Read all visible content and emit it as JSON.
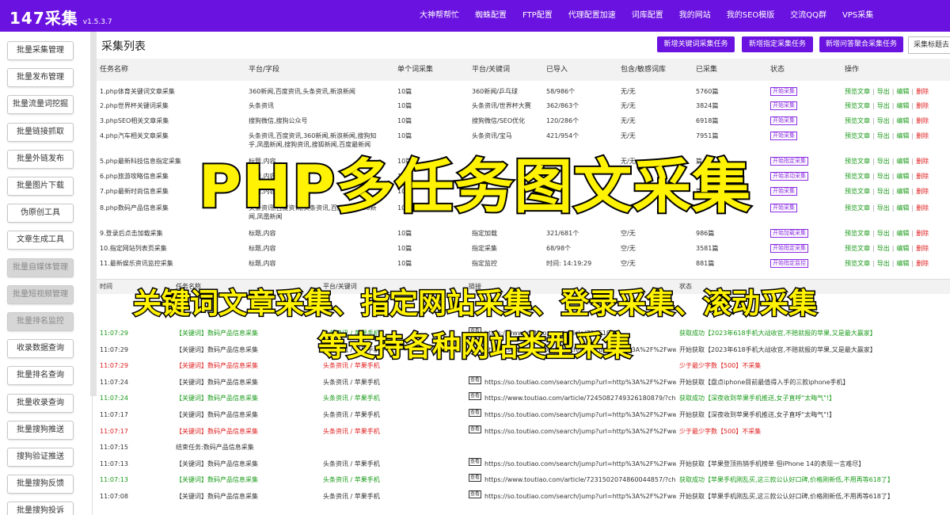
{
  "app": {
    "name": "147采集",
    "version": "v1.5.3.7"
  },
  "colors": {
    "brand": "#6a12e0",
    "green": "#1a9a1a",
    "red": "#e02020",
    "tag": "#8a2be2",
    "overlay": "#fff203"
  },
  "topnav": [
    "大神帮帮忙",
    "蜘蛛配置",
    "FTP配置",
    "代理配置加速",
    "词库配置",
    "我的网站",
    "我的SEO模版",
    "交流QQ群",
    "VPS采集"
  ],
  "sidebar": {
    "items": [
      {
        "label": "批量采集管理",
        "disabled": false
      },
      {
        "label": "批量发布管理",
        "disabled": false
      },
      {
        "label": "批量流量词挖掘",
        "disabled": false
      },
      {
        "label": "批量链接抓取",
        "disabled": false
      },
      {
        "label": "批量外链发布",
        "disabled": false
      },
      {
        "label": "批量图片下载",
        "disabled": false
      },
      {
        "label": "伪原创工具",
        "disabled": false
      },
      {
        "label": "文章生成工具",
        "disabled": false
      },
      {
        "label": "批量自媒体管理",
        "disabled": true
      },
      {
        "label": "批量短视频管理",
        "disabled": true
      },
      {
        "label": "批量排名监控",
        "disabled": true
      },
      {
        "label": "收录数据查询",
        "disabled": false
      },
      {
        "label": "批量排名查询",
        "disabled": false
      },
      {
        "label": "批量收录查询",
        "disabled": false
      },
      {
        "label": "批量搜狗推送",
        "disabled": false
      },
      {
        "label": "搜狗验证推送",
        "disabled": false
      },
      {
        "label": "批量搜狗反馈",
        "disabled": false
      },
      {
        "label": "批量搜狗投诉",
        "disabled": false
      }
    ]
  },
  "main": {
    "title": "采集列表",
    "actions": [
      "新增关键词采集任务",
      "新增指定采集任务",
      "新增问答聚合采集任务",
      "采集标题去"
    ],
    "task_columns": [
      "任务名称",
      "平台/字段",
      "单个词采集",
      "平台/关键词",
      "已导入",
      "包含/敏感词库",
      "已采集",
      "状态",
      "操作"
    ],
    "tasks": [
      {
        "name": "1.php体育关键词文章采集",
        "platform": "360新闻,百度资讯,头条资讯,新浪新闻",
        "single": "10篇",
        "keyword": "360新闻/乒乓球",
        "imported": "58/986个",
        "filter": "无/无",
        "collected": "5760篇",
        "status": "开始采集"
      },
      {
        "name": "2.php世界杯关键词采集",
        "platform": "头条资讯",
        "single": "10篇",
        "keyword": "头条资讯/世界杯大赛",
        "imported": "362/863个",
        "filter": "无/无",
        "collected": "3824篇",
        "status": "开始采集"
      },
      {
        "name": "3.phpSEO相关文章采集",
        "platform": "搜狗微信,搜狗公众号",
        "single": "10篇",
        "keyword": "搜狗微信/SEO优化",
        "imported": "120/286个",
        "filter": "无/无",
        "collected": "6918篇",
        "status": "开始采集"
      },
      {
        "name": "4.php汽车相关文章采集",
        "platform": "头条资讯,百度资讯,360新闻,新浪新闻,搜狗知乎,凤凰新闻,搜狗资讯,搜狐新闻,百度最新闻",
        "single": "10篇",
        "keyword": "头条资讯/宝马",
        "imported": "421/954个",
        "filter": "无/无",
        "collected": "7951篇",
        "status": "开始采集"
      },
      {
        "name": "5.php最新科技信息指定采集",
        "platform": "标题,内容",
        "single": "10篇",
        "keyword": "指定...",
        "imported": "",
        "filter": "无/无",
        "collected": "篇",
        "status": "开始指定采集"
      },
      {
        "name": "6.php旅游攻略信息采集",
        "platform": "标题,内容",
        "single": "10篇",
        "keyword": "",
        "imported": "",
        "filter": "",
        "collected": "篇",
        "status": "开始滚动采集"
      },
      {
        "name": "7.php最新时尚信息采集",
        "platform": "标题,内容",
        "single": "10篇",
        "keyword": "",
        "imported": "",
        "filter": "",
        "collected": "篇",
        "status": "开始采集"
      },
      {
        "name": "8.php数码产品信息采集",
        "platform": "头条资讯,百度资讯,头条资讯,百度资讯,360新闻,凤凰新闻",
        "single": "10篇",
        "keyword": "",
        "imported": "",
        "filter": "",
        "collected": "篇",
        "status": "开始采集"
      },
      {
        "name": "9.登录后点击加载采集",
        "platform": "标题,内容",
        "single": "10篇",
        "keyword": "指定加载",
        "imported": "321/681个",
        "filter": "空/无",
        "collected": "986篇",
        "status": "开始加载采集"
      },
      {
        "name": "10.指定网站列表页采集",
        "platform": "标题,内容",
        "single": "10篇",
        "keyword": "指定采集",
        "imported": "68/98个",
        "filter": "空/无",
        "collected": "3581篇",
        "status": "开始指定采集"
      },
      {
        "name": "11.最新娱乐资讯监控采集",
        "platform": "标题,内容",
        "single": "10篇",
        "keyword": "指定监控",
        "imported": "时间: 14:19:29",
        "filter": "空/无",
        "collected": "881篇",
        "status": "开始指定监控"
      }
    ],
    "operations": [
      "预览文章",
      "导出",
      "编辑",
      "删除"
    ],
    "log_columns": [
      "时间",
      "任务名称",
      "平台/关键词",
      "链接",
      "状态"
    ],
    "logs": [
      {
        "time": "11:07:29",
        "task": "【关键词】数码产品信息采集",
        "platform": "头条资讯 / 苹果手机",
        "url": "https://www.toutiao.com/article/72461809...",
        "status": "获取成功【2023年618手机大战收官,不赔就报的苹果,又是最大赢家】",
        "color": "green",
        "badge": true
      },
      {
        "time": "11:07:29",
        "task": "【关键词】数码产品信息采集",
        "platform": "头条资讯 / 苹果手机",
        "url": "https://so.toutiao.com/search/jump?url=http%3A%2F%2Fwww.touti...",
        "status": "开始获取【2023年618手机大战收官,不赔就报的苹果,又是最大赢家】",
        "color": "black",
        "badge": true
      },
      {
        "time": "11:07:29",
        "task": "【关键词】数码产品信息采集",
        "platform": "头条资讯 / 苹果手机",
        "url": "",
        "status": "少于最少字数【500】不采集",
        "color": "red",
        "badge": false
      },
      {
        "time": "11:07:24",
        "task": "【关键词】数码产品信息采集",
        "platform": "头条资讯 / 苹果手机",
        "url": "https://so.toutiao.com/search/jump?url=http%3A%2F%2Fwww.touti...",
        "status": "开始获取【盘点iphone目前最值得入手的三款iphone手机】",
        "color": "black",
        "badge": true
      },
      {
        "time": "11:07:24",
        "task": "【关键词】数码产品信息采集",
        "platform": "头条资讯 / 苹果手机",
        "url": "https://www.toutiao.com/article/7245082749326180879/?channel=&...",
        "status": "获取成功【深夜收到苹果手机推送,女子直呼\"太晦气\"!】",
        "color": "green",
        "badge": true
      },
      {
        "time": "11:07:17",
        "task": "【关键词】数码产品信息采集",
        "platform": "头条资讯 / 苹果手机",
        "url": "https://so.toutiao.com/search/jump?url=http%3A%2F%2Fwww.touti...",
        "status": "开始获取【深夜收到苹果手机推送,女子直呼\"太晦气\"!】",
        "color": "black",
        "badge": true
      },
      {
        "time": "11:07:17",
        "task": "【关键词】数码产品信息采集",
        "platform": "头条资讯 / 苹果手机",
        "url": "https://so.toutiao.com/search/jump?url=http%3A%2F%2Fwww.touti...",
        "status": "少于最少字数【500】不采集",
        "color": "red",
        "badge": true
      },
      {
        "time": "11:07:15",
        "task": "结束任务:数码产品信息采集",
        "platform": "",
        "url": "",
        "status": "",
        "color": "black",
        "badge": false
      },
      {
        "time": "11:07:13",
        "task": "【关键词】数码产品信息采集",
        "platform": "头条资讯 / 苹果手机",
        "url": "https://so.toutiao.com/search/jump?url=http%3A%2F%2Fwww.touti...",
        "status": "开始获取【苹果登顶热销手机榜单 但iPhone 14的表现一言难尽】",
        "color": "black",
        "badge": true
      },
      {
        "time": "11:07:13",
        "task": "【关键词】数码产品信息采集",
        "platform": "头条资讯 / 苹果手机",
        "url": "https://www.toutiao.com/article/7231502074860044857/?channel=&...",
        "status": "获取成功【苹果手机刚乱买,这三款公认好口碑,价格刚新低,不用再等618了】",
        "color": "green",
        "badge": true
      },
      {
        "time": "11:07:08",
        "task": "【关键词】数码产品信息采集",
        "platform": "头条资讯 / 苹果手机",
        "url": "https://so.toutiao.com/search/jump?url=http%3A%2F%2Fwww.touti...",
        "status": "开始获取【苹果手机刚乱买,这三款公认好口碑,价格刚新低,不用再等618了】",
        "color": "black",
        "badge": true
      }
    ]
  },
  "overlay": {
    "title": "PHP多任务图文采集",
    "line1": "关键词文章采集、指定网站采集、登录采集、滚动采集",
    "line2": "等支持各种网站类型采集"
  }
}
